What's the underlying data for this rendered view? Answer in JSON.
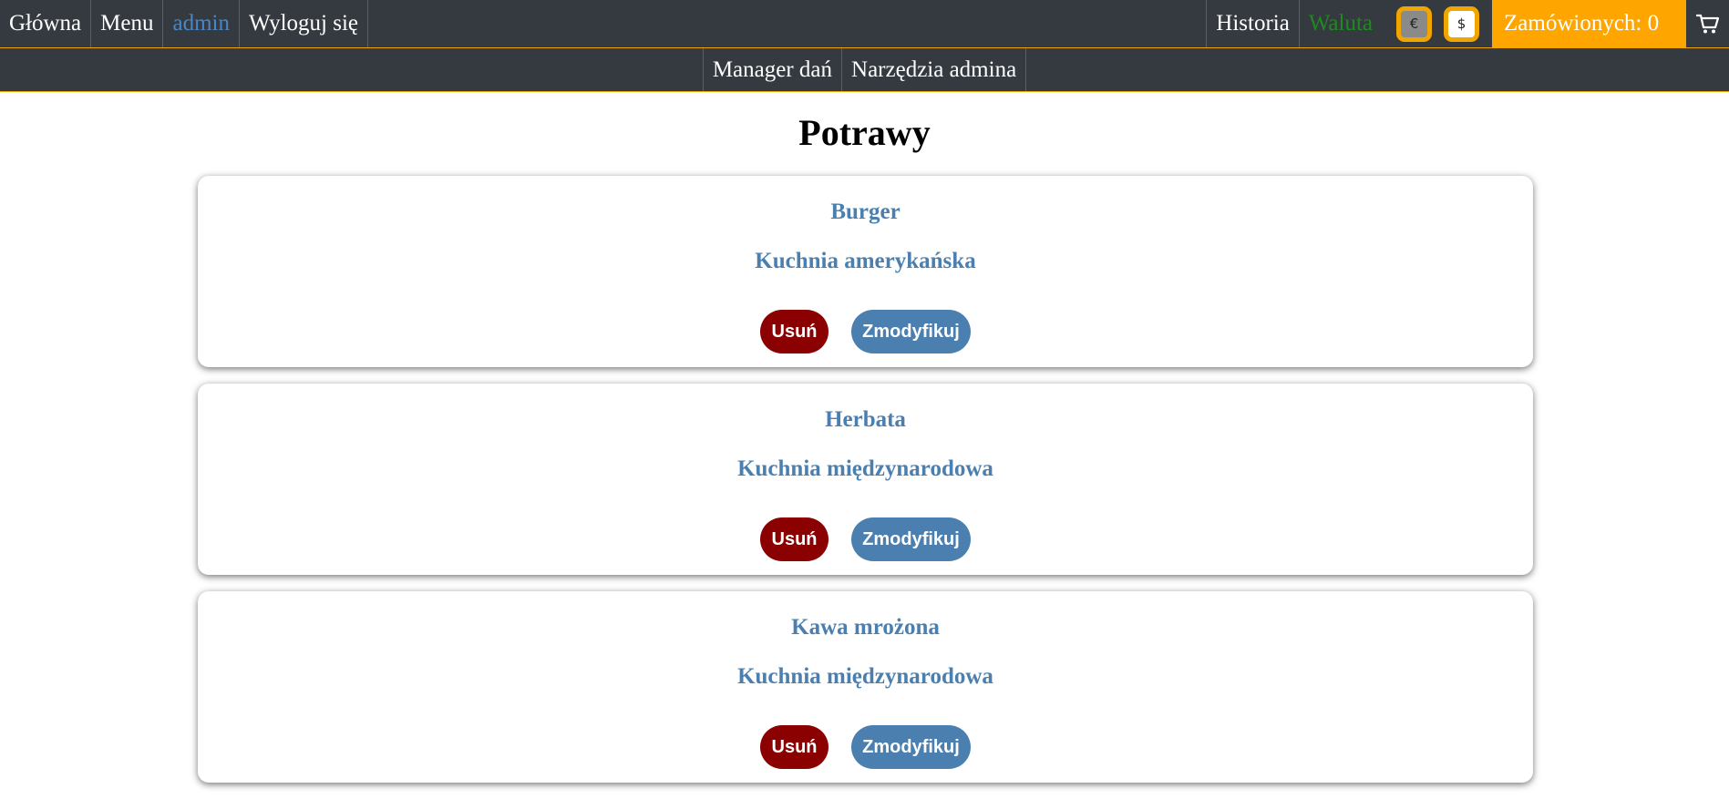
{
  "nav": {
    "home": "Główna",
    "menu": "Menu",
    "user": "admin",
    "logout": "Wyloguj się",
    "history": "Historia",
    "currency_label": "Waluta",
    "currency_eur": "€",
    "currency_usd": "$",
    "orders": "Zamówionych: 0",
    "cart_icon": "cart-icon"
  },
  "subnav": {
    "dish_manager": "Manager dań",
    "admin_tools": "Narzędzia admina"
  },
  "page": {
    "title": "Potrawy"
  },
  "dishes": [
    {
      "name": "Burger",
      "cuisine": "Kuchnia amerykańska",
      "delete_label": "Usuń",
      "modify_label": "Zmodyfikuj"
    },
    {
      "name": "Herbata",
      "cuisine": "Kuchnia międzynarodowa",
      "delete_label": "Usuń",
      "modify_label": "Zmodyfikuj"
    },
    {
      "name": "Kawa mrożona",
      "cuisine": "Kuchnia międzynarodowa",
      "delete_label": "Usuń",
      "modify_label": "Zmodyfikuj"
    }
  ],
  "colors": {
    "navbar_bg": "#343a40",
    "accent_orange": "#ffa500",
    "card_text": "#4a7fb0",
    "delete_button": "#8b0000",
    "modify_button": "#4a7fb0",
    "currency_label": "#1f8a1f"
  }
}
